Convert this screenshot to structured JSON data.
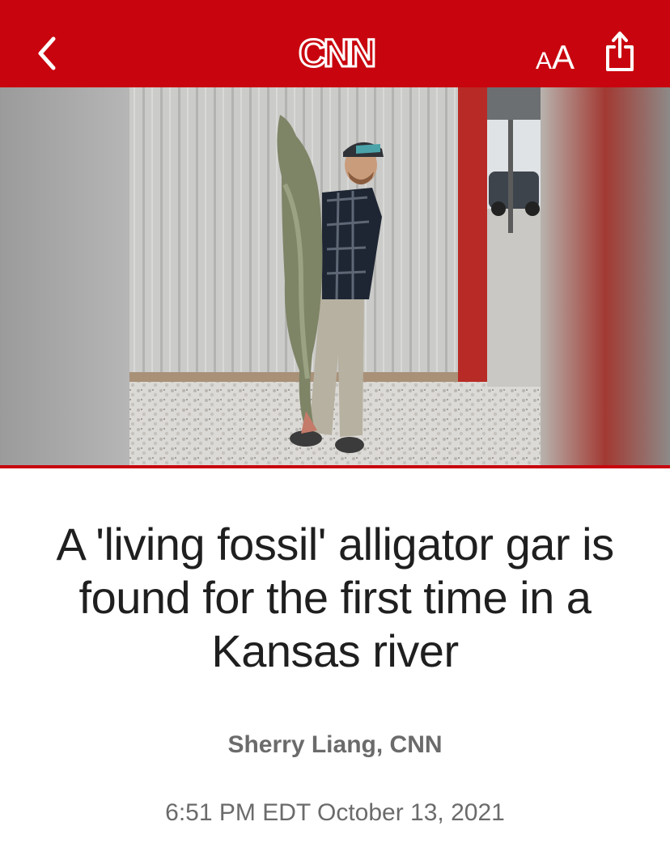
{
  "header": {
    "logo_text": "CNN",
    "text_size_small": "A",
    "text_size_large": "A",
    "background_color": "#c8050e",
    "back_icon": "chevron-left-icon",
    "share_icon": "share-icon"
  },
  "article": {
    "headline": "A 'living fossil' alligator gar is found for the first time in a Kansas river",
    "byline": "Sherry Liang, CNN",
    "timestamp": "6:51 PM EDT October 13, 2021"
  }
}
